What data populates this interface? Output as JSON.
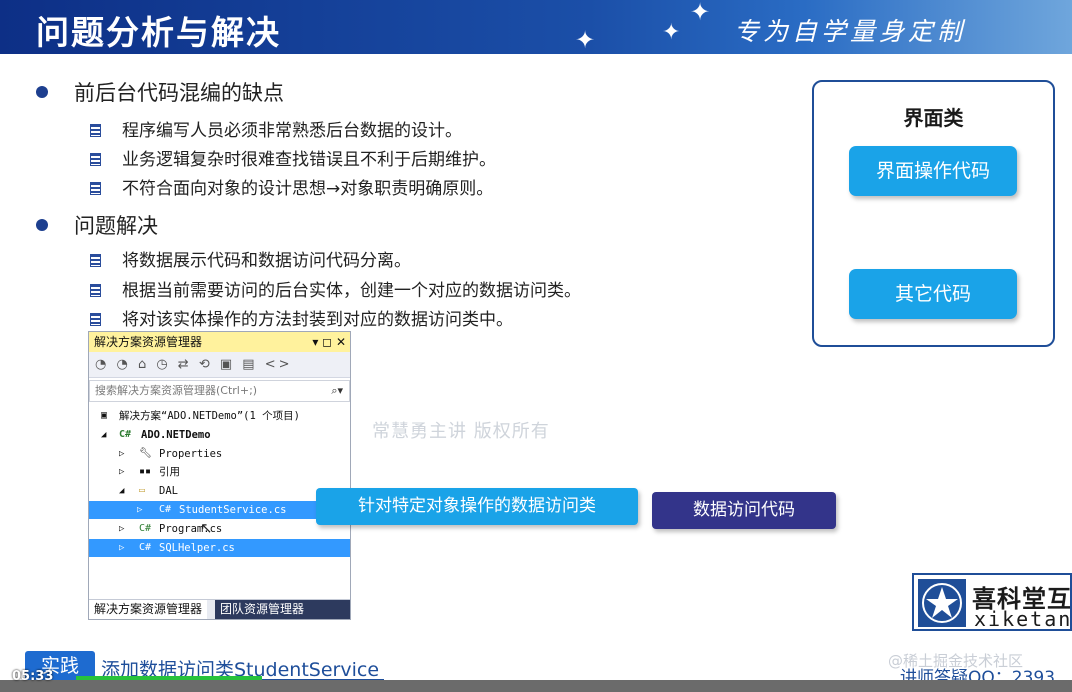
{
  "header": {
    "title": "问题分析与解决",
    "slogan": "专为自学量身定制"
  },
  "section1": {
    "heading": "前后台代码混编的缺点",
    "items": [
      "程序编写人员必须非常熟悉后台数据的设计。",
      "业务逻辑复杂时很难查找错误且不利于后期维护。",
      "不符合面向对象的设计思想→对象职责明确原则。"
    ]
  },
  "section2": {
    "heading": "问题解决",
    "items": [
      "将数据展示代码和数据访问代码分离。",
      "根据当前需要访问的后台实体，创建一个对应的数据访问类。",
      "将对该实体操作的方法封装到对应的数据访问类中。"
    ]
  },
  "ui_box": {
    "title": "界面类",
    "btn_ui_code": "界面操作代码",
    "btn_other_code": "其它代码"
  },
  "solution_explorer": {
    "title": "解决方案资源管理器",
    "title_controls": "▾ ◻ ✕",
    "toolbar_icons": "◔ ◔ ⌂ ◷ ⇄ ⟲ ▣ ▤ <>",
    "search_placeholder": "搜索解决方案资源管理器(Ctrl+;)",
    "tree": {
      "solution": "解决方案“ADO.NETDemo”(1 个项目)",
      "project": "ADO.NETDemo",
      "properties": "Properties",
      "references": "引用",
      "dal_folder": "DAL",
      "student_service": "StudentService.cs",
      "program": "Program.cs",
      "sqlhelper": "SQLHelper.cs"
    },
    "tab_active": "解决方案资源管理器",
    "tab_inactive": "团队资源管理器"
  },
  "watermark": "常慧勇主讲   版权所有",
  "callouts": {
    "specific_data_access": "针对特定对象操作的数据访问类",
    "data_access_code": "数据访问代码"
  },
  "logo": {
    "cn": "喜科堂互联",
    "en": "xiketang"
  },
  "bottom": {
    "practice_label": "实践",
    "practice_text": "添加数据访问类StudentService",
    "time": "05:33",
    "community": "@稀土掘金技术社区",
    "tutor": "讲师答疑QQ：2393"
  },
  "player": {
    "progress_fraction": 0.17
  },
  "colors": {
    "header_blue": "#0d2f86",
    "accent_cyan": "#1aa3e8",
    "callout_navy": "#33348a",
    "selection_blue": "#3399ff",
    "progress_green": "#27c23c"
  }
}
